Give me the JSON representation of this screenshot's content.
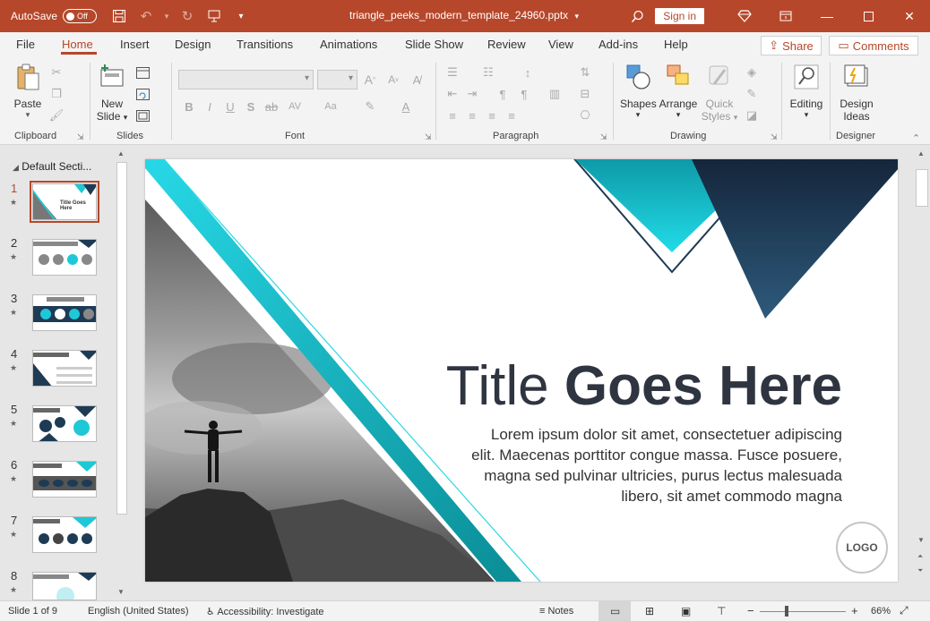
{
  "titlebar": {
    "autosave_label": "AutoSave",
    "autosave_state": "Off",
    "doc_title": "triangle_peeks_modern_template_24960.pptx",
    "signin_label": "Sign in"
  },
  "tabs": [
    "File",
    "Home",
    "Insert",
    "Design",
    "Transitions",
    "Animations",
    "Slide Show",
    "Review",
    "View",
    "Add-ins",
    "Help"
  ],
  "active_tab": "Home",
  "share_label": "Share",
  "comments_label": "Comments",
  "ribbon": {
    "paste_label": "Paste",
    "new_slide_line1": "New",
    "new_slide_line2": "Slide",
    "shapes_label": "Shapes",
    "arrange_label": "Arrange",
    "quick_styles_line1": "Quick",
    "quick_styles_line2": "Styles",
    "editing_label": "Editing",
    "design_ideas_line1": "Design",
    "design_ideas_line2": "Ideas",
    "groups": {
      "clipboard": "Clipboard",
      "slides": "Slides",
      "font": "Font",
      "paragraph": "Paragraph",
      "drawing": "Drawing",
      "designer": "Designer"
    }
  },
  "thumbnails": {
    "section_title": "Default Secti...",
    "numbers": [
      "1",
      "2",
      "3",
      "4",
      "5",
      "6",
      "7",
      "8"
    ],
    "slide1_title": "Title Goes Here"
  },
  "slide": {
    "title_regular": "Title ",
    "title_bold": "Goes Here",
    "body_lines": [
      "Lorem ipsum dolor sit amet, consectetuer adipiscing",
      "elit. Maecenas porttitor congue massa. Fusce posuere,",
      "magna sed pulvinar ultricies, purus lectus malesuada",
      "libero, sit amet commodo magna"
    ],
    "logo_text": "LOGO"
  },
  "status": {
    "slide_info": "Slide 1 of 9",
    "language": "English (United States)",
    "accessibility": "Accessibility: Investigate",
    "notes_label": "Notes",
    "zoom": "66%"
  },
  "colors": {
    "accent": "#b7472a",
    "teal": "#1fc8d6",
    "navy": "#1e3b55"
  }
}
